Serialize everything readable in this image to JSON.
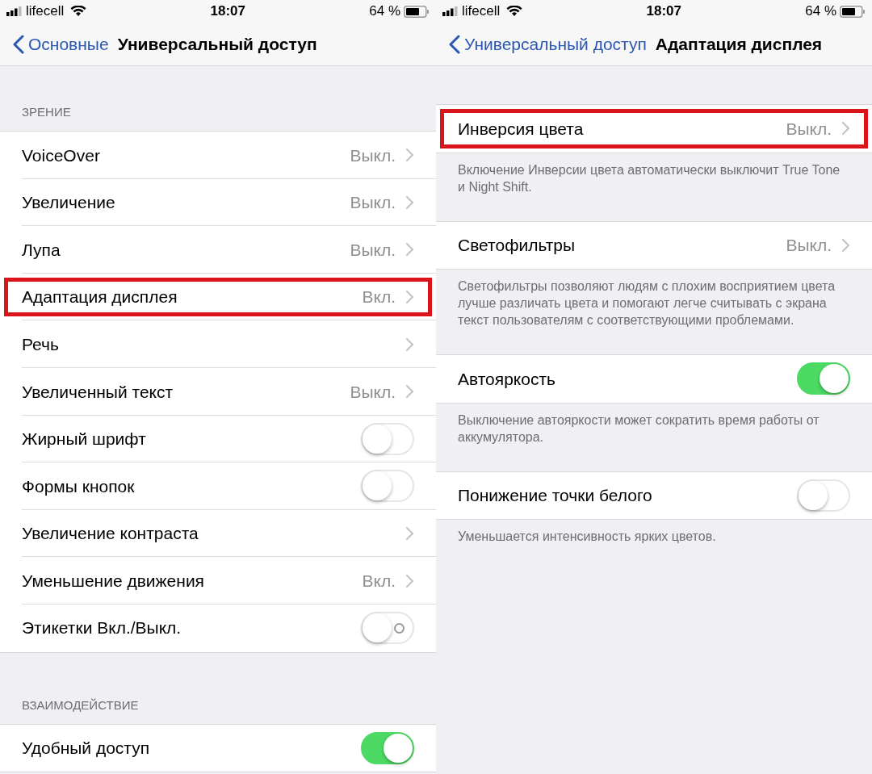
{
  "screens": [
    {
      "status_bar": {
        "carrier": "lifecell",
        "time": "18:07",
        "battery": "64 %"
      },
      "nav": {
        "back": "Основные",
        "title": "Универсальный доступ"
      },
      "groups": [
        {
          "header": "ЗРЕНИЕ",
          "rows": [
            {
              "kind": "value",
              "label": "VoiceOver",
              "value": "Выкл.",
              "highlighted": false
            },
            {
              "kind": "value",
              "label": "Увеличение",
              "value": "Выкл.",
              "highlighted": false
            },
            {
              "kind": "value",
              "label": "Лупа",
              "value": "Выкл.",
              "highlighted": false
            },
            {
              "kind": "value",
              "label": "Адаптация дисплея",
              "value": "Вкл.",
              "highlighted": true
            },
            {
              "kind": "link",
              "label": "Речь",
              "highlighted": false
            },
            {
              "kind": "value",
              "label": "Увеличенный текст",
              "value": "Выкл.",
              "highlighted": false
            },
            {
              "kind": "toggle",
              "label": "Жирный шрифт",
              "on": false,
              "highlighted": false
            },
            {
              "kind": "toggle",
              "label": "Формы кнопок",
              "on": false,
              "highlighted": false
            },
            {
              "kind": "link",
              "label": "Увеличение контраста",
              "highlighted": false
            },
            {
              "kind": "value",
              "label": "Уменьшение движения",
              "value": "Вкл.",
              "highlighted": false
            },
            {
              "kind": "toggle",
              "label": "Этикетки Вкл./Выкл.",
              "on": false,
              "off_mark": true,
              "highlighted": false
            }
          ]
        },
        {
          "header": "ВЗАИМОДЕЙСТВИЕ",
          "rows": [
            {
              "kind": "toggle",
              "label": "Удобный доступ",
              "on": true,
              "highlighted": false
            }
          ]
        }
      ]
    },
    {
      "status_bar": {
        "carrier": "lifecell",
        "time": "18:07",
        "battery": "64 %"
      },
      "nav": {
        "back": "Универсальный доступ",
        "title": "Адаптация дисплея"
      },
      "groups": [
        {
          "rows": [
            {
              "kind": "value",
              "label": "Инверсия цвета",
              "value": "Выкл.",
              "highlighted": true
            }
          ],
          "footer": "Включение Инверсии цвета автоматически выключит True Tone и Night Shift."
        },
        {
          "rows": [
            {
              "kind": "value",
              "label": "Светофильтры",
              "value": "Выкл.",
              "highlighted": false
            }
          ],
          "footer": "Светофильтры позволяют людям с плохим восприятием цвета лучше различать цвета и помогают легче считывать с экрана текст пользователям с соответствующими проблемами."
        },
        {
          "rows": [
            {
              "kind": "toggle",
              "label": "Автояркость",
              "on": true,
              "highlighted": false
            }
          ],
          "footer": "Выключение автояркости может сократить время работы от аккумулятора."
        },
        {
          "rows": [
            {
              "kind": "toggle",
              "label": "Понижение точки белого",
              "on": false,
              "highlighted": false
            }
          ],
          "footer": "Уменьшается интенсивность ярких цветов."
        }
      ]
    }
  ]
}
